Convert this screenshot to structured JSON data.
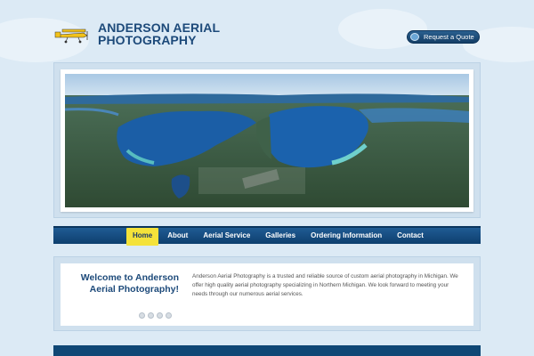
{
  "header": {
    "brand_line1": "ANDERSON AERIAL",
    "brand_line2": "PHOTOGRAPHY",
    "quote_button": "Request a Quote"
  },
  "nav": {
    "items": [
      {
        "label": "Home",
        "active": true
      },
      {
        "label": "About",
        "active": false
      },
      {
        "label": "Aerial Service",
        "active": false
      },
      {
        "label": "Galleries",
        "active": false
      },
      {
        "label": "Ordering Information",
        "active": false
      },
      {
        "label": "Contact",
        "active": false
      }
    ]
  },
  "welcome": {
    "title": "Welcome to Anderson Aerial Photography!",
    "body": "Anderson Aerial Photography is a trusted and reliable source of custom aerial photography in Michigan. We offer high quality aerial photography specializing in Northern Michigan. We look forward to meeting your needs through our numerous aerial services."
  },
  "colors": {
    "brand": "#1d4a7a",
    "nav": "#14497c",
    "nav_active": "#f4e23a",
    "background": "#dceaf5"
  },
  "icons": {
    "plane": "airplane-logo-icon",
    "quote": "circle-bullet-icon"
  }
}
